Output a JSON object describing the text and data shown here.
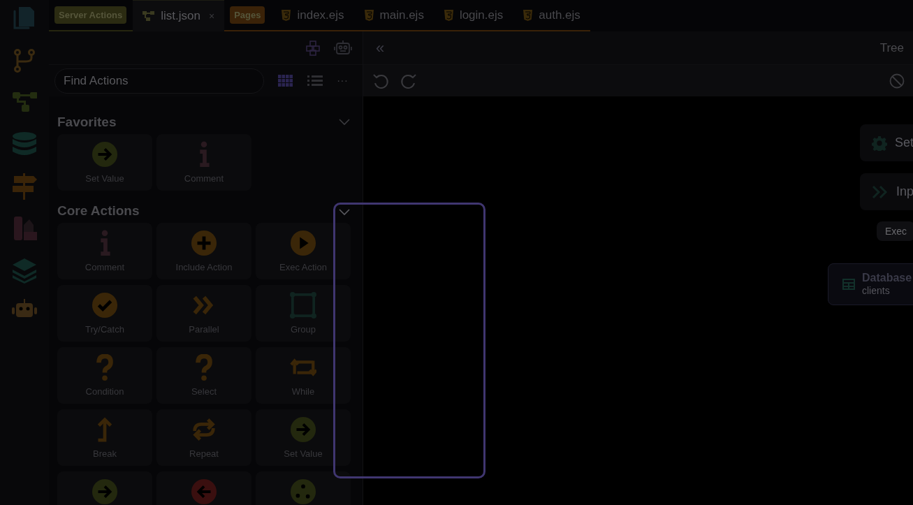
{
  "tab_groups": [
    {
      "label": "Server Actions",
      "color": "#2b2b12",
      "tabs": [
        {
          "label": "list.json",
          "kind": "json",
          "selected": true,
          "close": "×"
        }
      ]
    },
    {
      "label": "Pages",
      "color": "#3a2208",
      "tabs": [
        {
          "label": "index.ejs",
          "kind": "html",
          "selected": false
        },
        {
          "label": "main.ejs",
          "kind": "html",
          "selected": false
        },
        {
          "label": "login.ejs",
          "kind": "html",
          "selected": false
        },
        {
          "label": "auth.ejs",
          "kind": "html",
          "selected": false
        }
      ]
    }
  ],
  "actions_panel": {
    "search": {
      "placeholder": "Find Actions"
    },
    "view_buttons": [
      {
        "kind": "grid",
        "selected": true
      },
      {
        "kind": "list",
        "selected": false
      }
    ],
    "more": "···",
    "sections": [
      {
        "title": "Favorites",
        "expanded": true,
        "items": [
          {
            "label": "Set Value",
            "kind": "set"
          },
          {
            "label": "Comment",
            "kind": "comment"
          }
        ]
      },
      {
        "title": "Core Actions",
        "items": [
          {
            "label": "Comment",
            "kind": "comment"
          },
          {
            "label": "Include Action",
            "kind": "include"
          },
          {
            "label": "Exec Action",
            "kind": "exec"
          },
          {
            "label": "Try/Catch",
            "kind": "try"
          },
          {
            "label": "Parallel",
            "kind": "parallel"
          },
          {
            "label": "Group",
            "kind": "group"
          },
          {
            "label": "Condition",
            "kind": "question"
          },
          {
            "label": "Select",
            "kind": "question"
          },
          {
            "label": "While",
            "kind": "while"
          },
          {
            "label": "Break",
            "kind": "break"
          },
          {
            "label": "Repeat",
            "kind": "repeat"
          },
          {
            "label": "Set Value",
            "kind": "set"
          },
          {
            "kind": "set"
          },
          {
            "kind": "back"
          },
          {
            "kind": "dots"
          }
        ]
      }
    ]
  },
  "editor": {
    "collapse": "«",
    "mode": "Tree",
    "nodes": [
      {
        "kind": "gear",
        "label": "Set"
      },
      {
        "kind": "chevrons",
        "label": "Inp"
      },
      {
        "kind": "pill",
        "label": "Exec"
      },
      {
        "kind": "table",
        "label": "Database",
        "sublabel": "clients"
      }
    ]
  }
}
